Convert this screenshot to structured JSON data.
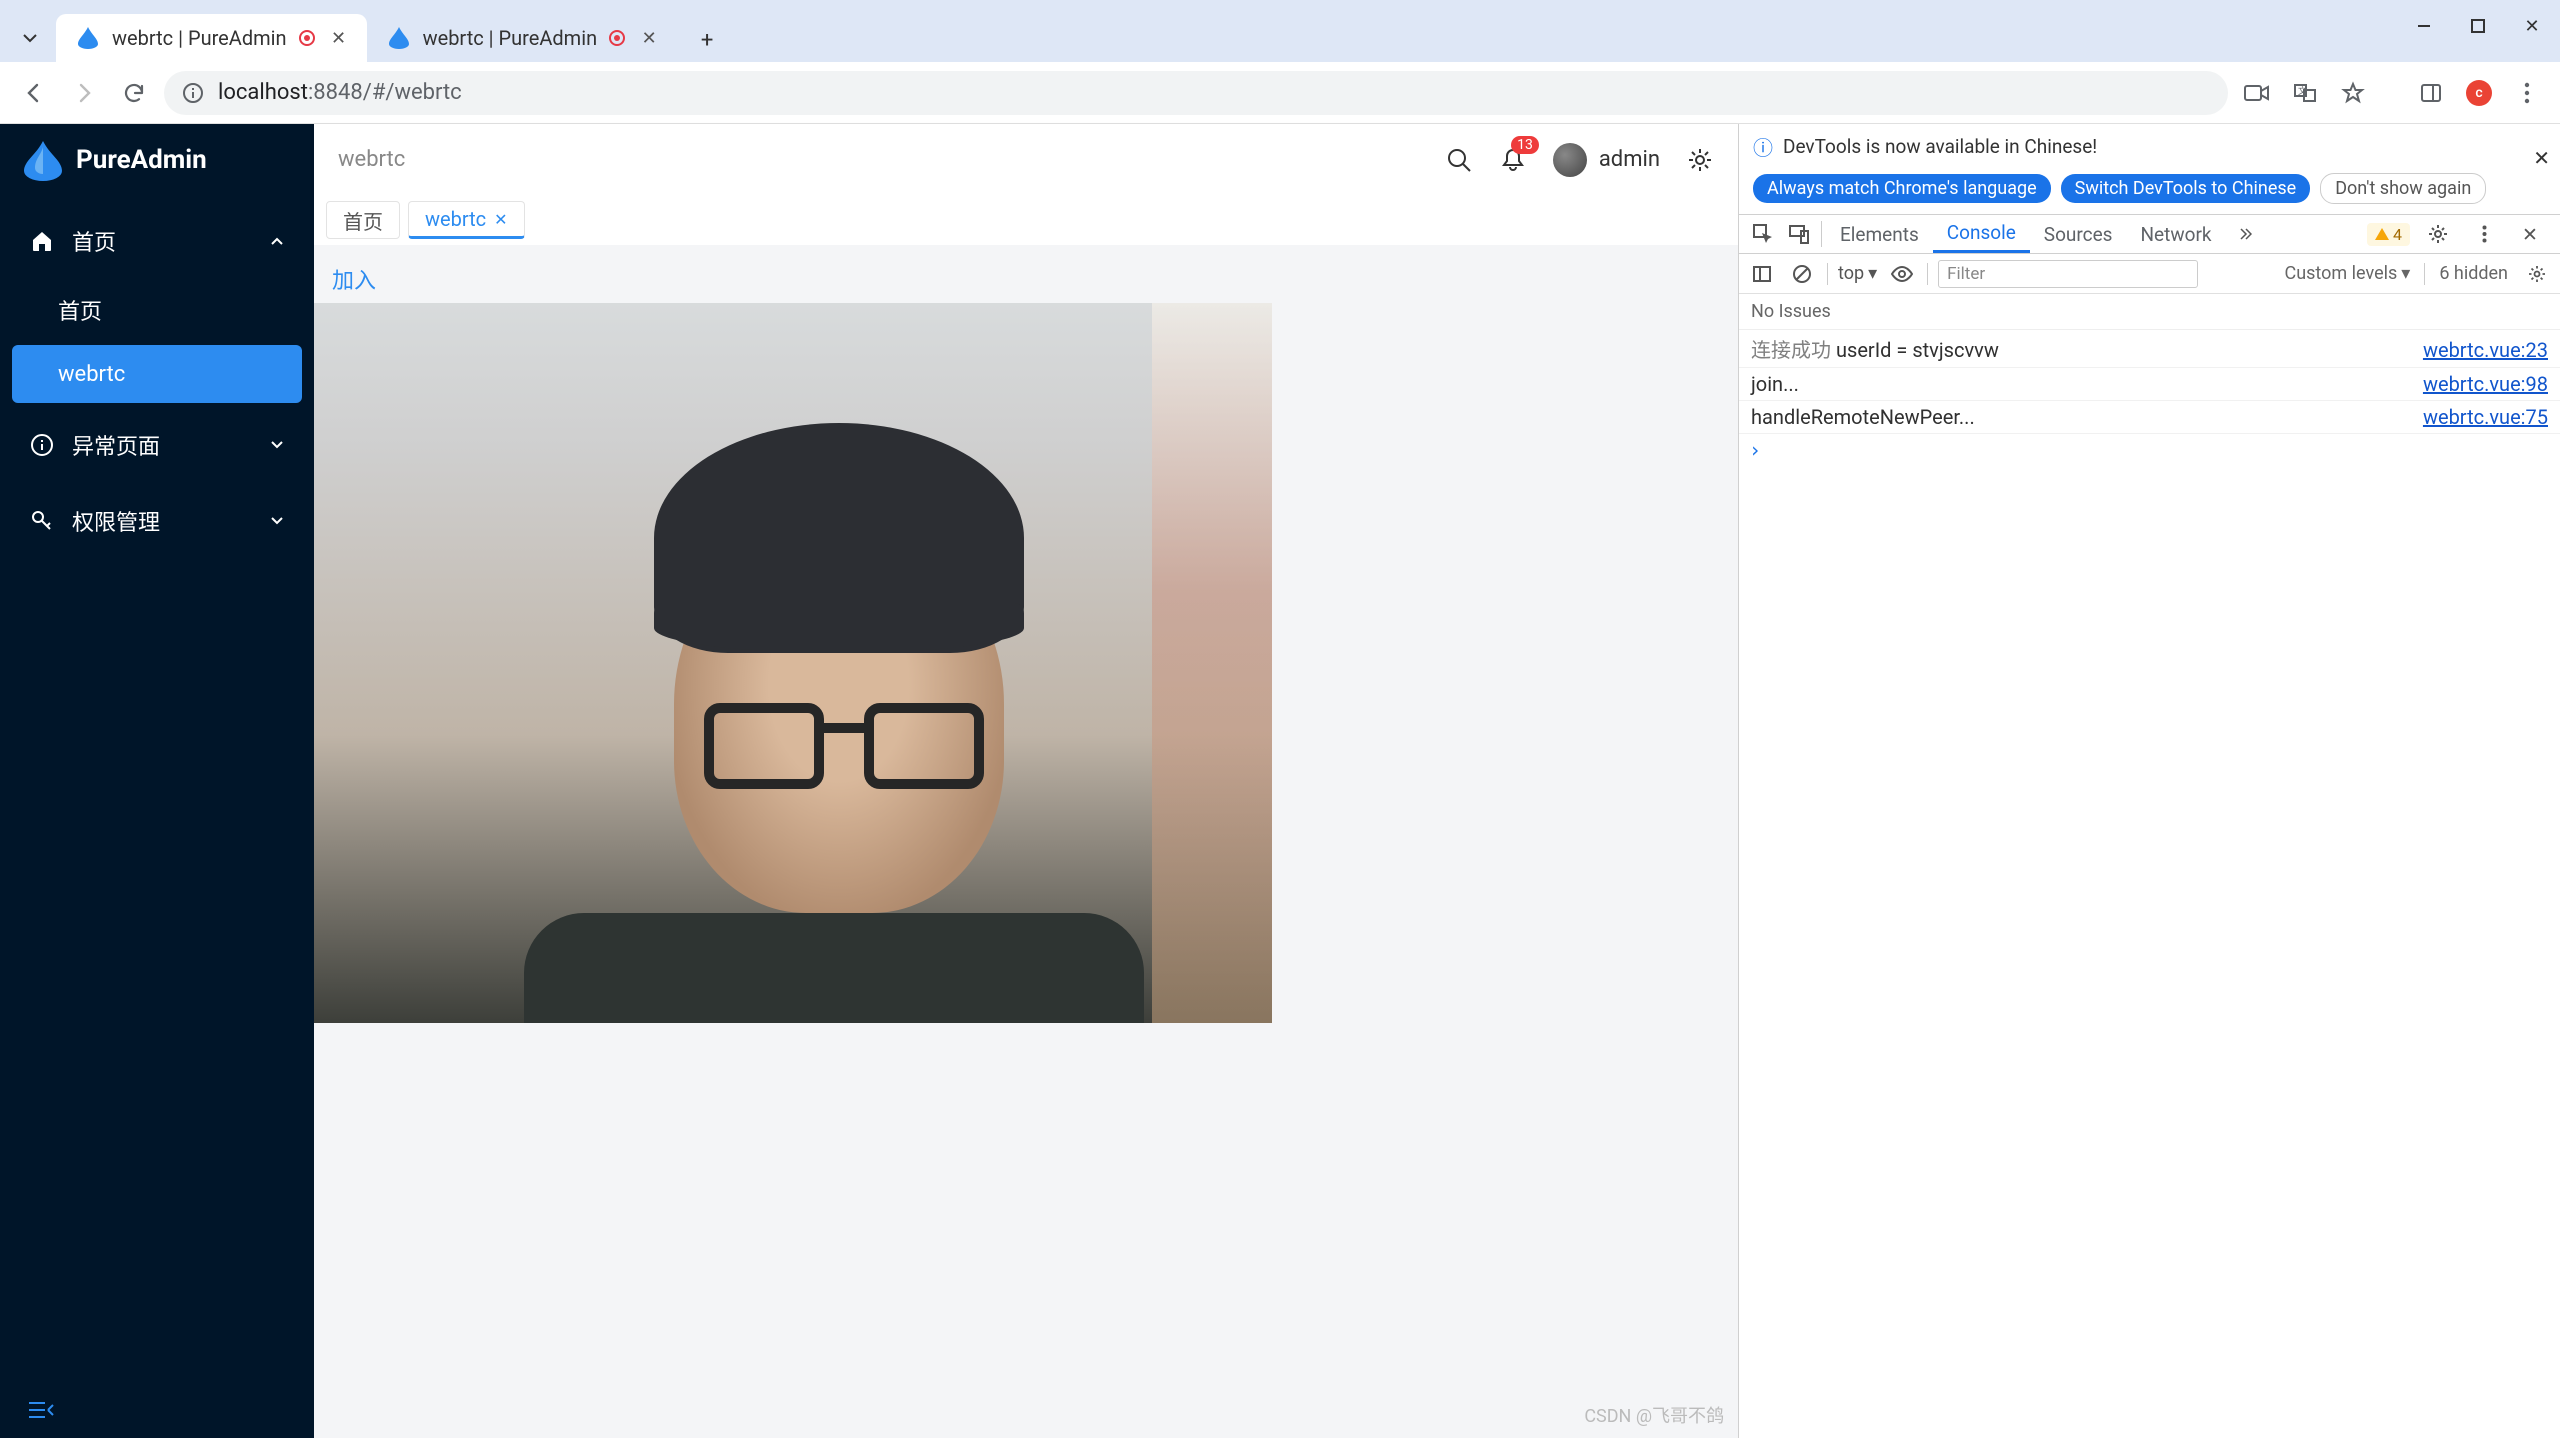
{
  "browser": {
    "tabs": [
      {
        "title": "webrtc | PureAdmin",
        "active": true
      },
      {
        "title": "webrtc | PureAdmin",
        "active": false
      }
    ],
    "url_host": "localhost",
    "url_port_path": ":8848/#/webrtc",
    "profile_initial": "c"
  },
  "sidebar": {
    "app_name": "PureAdmin",
    "items": [
      {
        "label": "首页",
        "icon": "home",
        "expanded": true,
        "children": [
          {
            "label": "首页",
            "active": false
          },
          {
            "label": "webrtc",
            "active": true
          }
        ]
      },
      {
        "label": "异常页面",
        "icon": "info",
        "expanded": false
      },
      {
        "label": "权限管理",
        "icon": "key",
        "expanded": false
      }
    ]
  },
  "header": {
    "breadcrumb": "webrtc",
    "notification_count": "13",
    "username": "admin"
  },
  "tabs_bar": {
    "items": [
      {
        "label": "首页",
        "active": false,
        "closable": false
      },
      {
        "label": "webrtc",
        "active": true,
        "closable": true
      }
    ]
  },
  "content": {
    "join_label": "加入"
  },
  "devtools": {
    "info_text": "DevTools is now available in Chinese!",
    "chip_always": "Always match Chrome's language",
    "chip_switch": "Switch DevTools to Chinese",
    "chip_dont": "Don't show again",
    "panels": [
      "Elements",
      "Console",
      "Sources",
      "Network"
    ],
    "active_panel": "Console",
    "warnings": "4",
    "console_toolbar": {
      "context": "top",
      "filter_placeholder": "Filter",
      "levels": "Custom levels",
      "hidden": "6 hidden"
    },
    "issues_text": "No Issues",
    "logs": [
      {
        "prefix": "连接成功",
        "msg": "userId = stvjscvvw",
        "src": "webrtc.vue:23"
      },
      {
        "prefix": "",
        "msg": "join...",
        "src": "webrtc.vue:98"
      },
      {
        "prefix": "",
        "msg": "handleRemoteNewPeer...",
        "src": "webrtc.vue:75"
      }
    ]
  },
  "watermark": "CSDN @飞哥不鸽"
}
